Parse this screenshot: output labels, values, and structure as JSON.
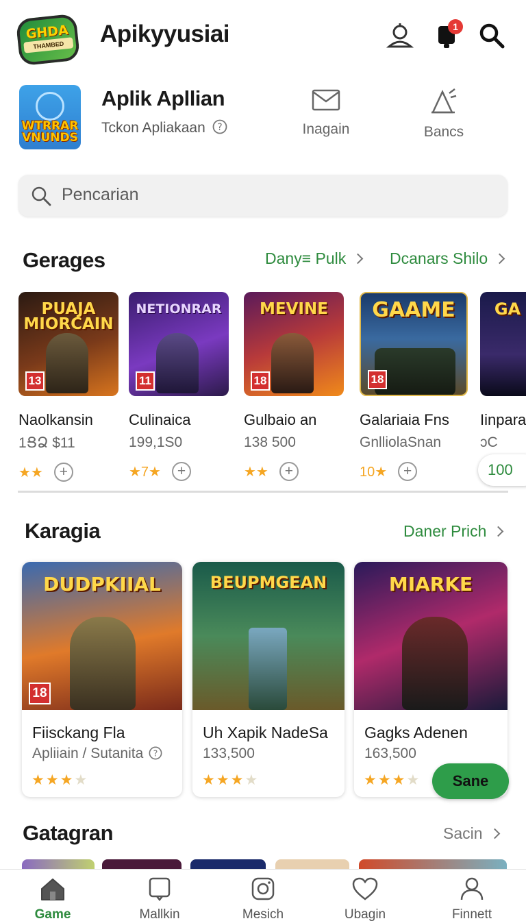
{
  "header": {
    "logo_text": "GHDA",
    "logo_subtext": "THAMBED",
    "title": "Apikyyusiai",
    "notification_count": "1"
  },
  "featured_app": {
    "icon_text": "WTRRAR VNUNDS",
    "name": "Aplik Apllian",
    "subtitle": "Tckon Apliakaan",
    "actions": [
      {
        "label": "Inagain",
        "icon": "mail-icon"
      },
      {
        "label": "Bancs",
        "icon": "cone-icon"
      }
    ]
  },
  "search": {
    "placeholder": "Pencarian"
  },
  "section1": {
    "title": "Gerages",
    "links": [
      "Dany≡ Pulk",
      "Dcanars Shilo"
    ],
    "cards": [
      {
        "headline": "PUAJA MIORCAIN",
        "age": "13",
        "name": "Naolkansin",
        "meta": "1ՑՁ $11",
        "rating": "★★"
      },
      {
        "headline": "NETIONRAR",
        "age": "11",
        "name": "Culinaica",
        "meta": "199,1S0",
        "rating": "★7★"
      },
      {
        "headline": "MEVINE",
        "age": "18",
        "name": "Gulbaio an",
        "meta": "138 500",
        "rating": "★★"
      },
      {
        "headline": "GAAME",
        "age": "18",
        "name": "Galariaia Fns",
        "meta": "GnlliolaSnan",
        "rating": "10★"
      },
      {
        "headline": "GA",
        "age": "",
        "name": "Iinpara",
        "meta": "ɔC",
        "rating": ""
      }
    ],
    "pill_value": "100"
  },
  "section2": {
    "title": "Karagia",
    "link": "Daner Prich",
    "cards": [
      {
        "headline": "DUDPKIIAL",
        "age": "18",
        "name": "Fiisckang Fla",
        "meta": "Apliiain / Sutanita",
        "stars_on": "★★★",
        "stars_off": "★"
      },
      {
        "headline": "BEUPMGEAN",
        "age": "",
        "name": "Uh Xapik NadeSa",
        "meta": "133,500",
        "stars_on": "★★★",
        "stars_off": "★"
      },
      {
        "headline": "MIARKE",
        "age": "",
        "name": "Gagks Adenen",
        "meta": "163,500",
        "stars_on": "★★★",
        "stars_off": "★"
      }
    ],
    "save_label": "Sane"
  },
  "section3": {
    "title": "Gatagran",
    "link": "Sacin"
  },
  "bottom_nav": [
    {
      "label": "Game",
      "icon": "home-icon",
      "active": true
    },
    {
      "label": "Mallkin",
      "icon": "tablet-icon"
    },
    {
      "label": "Mesich",
      "icon": "camera-icon"
    },
    {
      "label": "Ubagin",
      "icon": "heart-icon"
    },
    {
      "label": "Finnett",
      "icon": "profile-icon"
    }
  ],
  "colors": {
    "accent_green": "#2e8b3e",
    "button_green": "#2e9d4a",
    "badge_red": "#e53935",
    "star": "#f5a623"
  }
}
